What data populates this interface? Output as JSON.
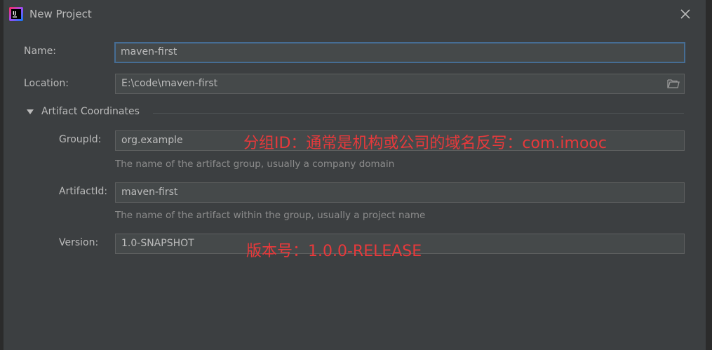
{
  "dialog": {
    "title": "New Project",
    "close_icon": "close-icon",
    "app_icon": "intellij-idea-icon"
  },
  "form": {
    "name": {
      "label": "Name:",
      "value": "maven-first"
    },
    "location": {
      "label": "Location:",
      "value": "E:\\code\\maven-first",
      "browse_icon": "folder-icon"
    },
    "artifact_section": {
      "label": "Artifact Coordinates",
      "expanded": true
    },
    "group_id": {
      "label": "GroupId:",
      "value": "org.example",
      "hint": "The name of the artifact group, usually a company domain"
    },
    "artifact_id": {
      "label": "ArtifactId:",
      "value": "maven-first",
      "hint": "The name of the artifact within the group, usually a project name"
    },
    "version": {
      "label": "Version:",
      "value": "1.0-SNAPSHOT"
    }
  },
  "annotations": {
    "group_note": "分组ID：通常是机构或公司的域名反写：com.imooc",
    "version_note": "版本号：1.0.0-RELEASE"
  },
  "colors": {
    "background": "#3c3f41",
    "field_background": "#45494a",
    "focus_border": "#466d94",
    "text": "#bbbbbb",
    "hint_text": "#8c8c8c",
    "annotation": "#e8393b"
  }
}
